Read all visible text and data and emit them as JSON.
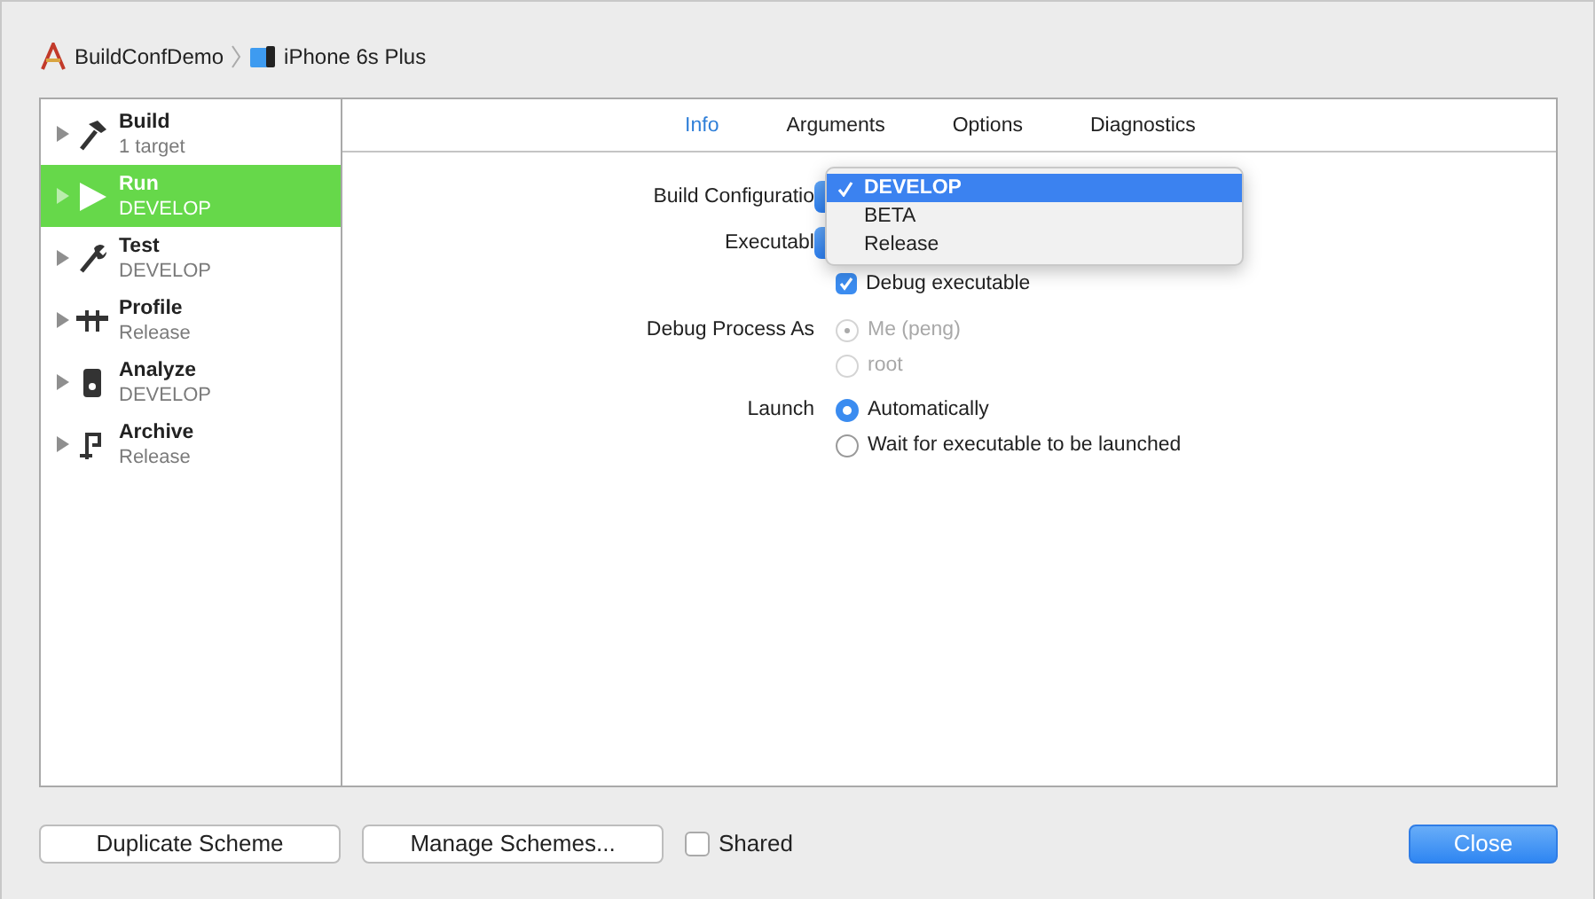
{
  "breadcrumb": [
    {
      "label": "BuildConfDemo"
    },
    {
      "label": "iPhone 6s Plus"
    }
  ],
  "actions": [
    {
      "name": "Build",
      "detail": "1 target",
      "selected": false
    },
    {
      "name": "Run",
      "detail": "DEVELOP",
      "selected": true
    },
    {
      "name": "Test",
      "detail": "DEVELOP",
      "selected": false
    },
    {
      "name": "Profile",
      "detail": "Release",
      "selected": false
    },
    {
      "name": "Analyze",
      "detail": "DEVELOP",
      "selected": false
    },
    {
      "name": "Archive",
      "detail": "Release",
      "selected": false
    }
  ],
  "tabs": [
    {
      "label": "Info",
      "selected": true
    },
    {
      "label": "Arguments",
      "selected": false
    },
    {
      "label": "Options",
      "selected": false
    },
    {
      "label": "Diagnostics",
      "selected": false
    }
  ],
  "build_configuration": {
    "label": "Build Configuratio",
    "menu": [
      {
        "label": "DEVELOP",
        "selected": true
      },
      {
        "label": "BETA",
        "selected": false
      },
      {
        "label": "Release",
        "selected": false
      }
    ]
  },
  "executable": {
    "label": "Executabl"
  },
  "debug_executable": {
    "label": "Debug executable",
    "checked": true
  },
  "debug_process_as": {
    "label": "Debug Process As",
    "disabled": true,
    "options": [
      {
        "label": "Me (peng)",
        "selected": true
      },
      {
        "label": "root",
        "selected": false
      }
    ]
  },
  "launch": {
    "label": "Launch",
    "disabled": false,
    "options": [
      {
        "label": "Automatically",
        "selected": true
      },
      {
        "label": "Wait for executable to be launched",
        "selected": false
      }
    ]
  },
  "footer": {
    "buttons": [
      {
        "label": "Duplicate Scheme"
      },
      {
        "label": "Manage Schemes..."
      }
    ],
    "shared": {
      "label": "Shared",
      "checked": false
    },
    "close": "Close"
  }
}
